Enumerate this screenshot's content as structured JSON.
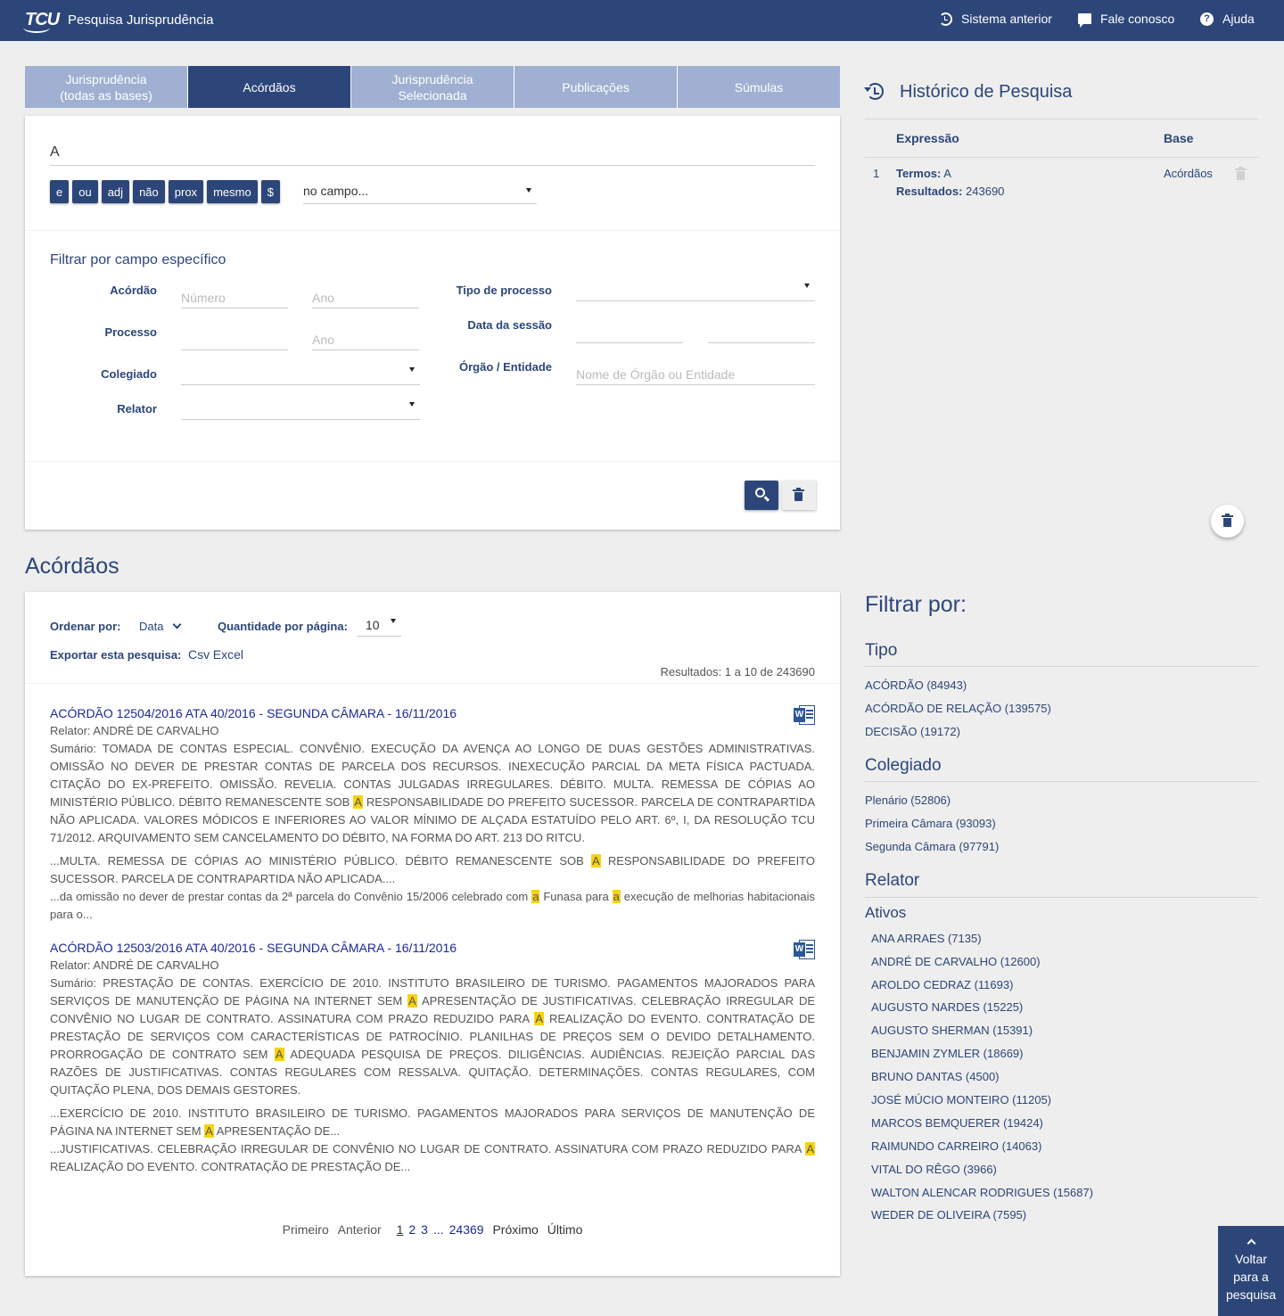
{
  "header": {
    "logo_text": "TCU",
    "title": "Pesquisa Jurisprudência",
    "nav": [
      {
        "label": "Sistema anterior",
        "icon": "history-icon"
      },
      {
        "label": "Fale conosco",
        "icon": "chat-icon"
      },
      {
        "label": "Ajuda",
        "icon": "help-icon"
      }
    ]
  },
  "tabs": [
    {
      "line1": "Jurisprudência",
      "line2": "(todas as bases)",
      "active": false
    },
    {
      "line1": "Acórdãos",
      "line2": "",
      "active": true
    },
    {
      "line1": "Jurisprudência",
      "line2": "Selecionada",
      "active": false
    },
    {
      "line1": "Publicações",
      "line2": "",
      "active": false
    },
    {
      "line1": "Súmulas",
      "line2": "",
      "active": false
    }
  ],
  "search": {
    "query": "A",
    "operators": [
      "e",
      "ou",
      "adj",
      "não",
      "prox",
      "mesmo",
      "$"
    ],
    "field_select": "no campo...",
    "filter_title": "Filtrar por campo específico",
    "labels": {
      "acordao": "Acórdão",
      "processo": "Processo",
      "colegiado": "Colegiado",
      "relator": "Relator",
      "tipo_processo": "Tipo de processo",
      "data_sessao": "Data da sessão",
      "orgao": "Órgão / Entidade"
    },
    "placeholders": {
      "numero": "Número",
      "ano": "Ano",
      "orgao": "Nome de Órgão ou Entidade"
    }
  },
  "history": {
    "title": "Histórico de Pesquisa",
    "col_expressao": "Expressão",
    "col_base": "Base",
    "rows": [
      {
        "index": "1",
        "termos_label": "Termos:",
        "termos": "A",
        "resultados_label": "Resultados:",
        "resultados": "243690",
        "base": "Acórdãos"
      }
    ]
  },
  "results": {
    "heading": "Acórdãos",
    "ordenar_label": "Ordenar por:",
    "ordenar_value": "Data",
    "qtd_label": "Quantidade por página:",
    "qtd_value": "10",
    "exportar_label": "Exportar esta pesquisa:",
    "export_csv": "Csv",
    "export_excel": "Excel",
    "count_text": "Resultados: 1 a 10 de 243690",
    "items": [
      {
        "title": "ACÓRDÃO 12504/2016 ATA 40/2016 - SEGUNDA CÂMARA - 16/11/2016",
        "relator": "Relator: ANDRÉ DE CARVALHO"
      },
      {
        "title": "ACÓRDÃO 12503/2016 ATA 40/2016 - SEGUNDA CÂMARA - 16/11/2016",
        "relator": "Relator: ANDRÉ DE CARVALHO"
      }
    ],
    "pager": {
      "first": "Primeiro",
      "prev": "Anterior",
      "pages": [
        "1",
        "2",
        "3",
        "...",
        "24369"
      ],
      "next": "Próximo",
      "last": "Último"
    }
  },
  "filters": {
    "title": "Filtrar por:",
    "tipo_title": "Tipo",
    "tipo": [
      "ACÓRDÃO (84943)",
      "ACÓRDÃO DE RELAÇÃO (139575)",
      "DECISÃO (19172)"
    ],
    "colegiado_title": "Colegiado",
    "colegiado": [
      "Plenário (52806)",
      "Primeira Câmara (93093)",
      "Segunda Câmara (97791)"
    ],
    "relator_title": "Relator",
    "ativos_title": "Ativos",
    "relatores": [
      "ANA ARRAES (7135)",
      "ANDRÉ DE CARVALHO (12600)",
      "AROLDO CEDRAZ (11693)",
      "AUGUSTO NARDES (15225)",
      "AUGUSTO SHERMAN (15391)",
      "BENJAMIN ZYMLER (18669)",
      "BRUNO DANTAS (4500)",
      "JOSÉ MÚCIO MONTEIRO (11205)",
      "MARCOS BEMQUERER (19424)",
      "RAIMUNDO CARREIRO (14063)",
      "VITAL DO RÊGO (3966)",
      "WALTON ALENCAR RODRIGUES (15687)",
      "WEDER DE OLIVEIRA (7595)"
    ]
  },
  "back_button": {
    "line1": "Voltar",
    "line2": "para a",
    "line3": "pesquisa"
  },
  "colors": {
    "brand": "#2c4679",
    "tab_inactive": "#a0b0d2",
    "highlight": "#f8d210",
    "link": "#1a2a96"
  }
}
